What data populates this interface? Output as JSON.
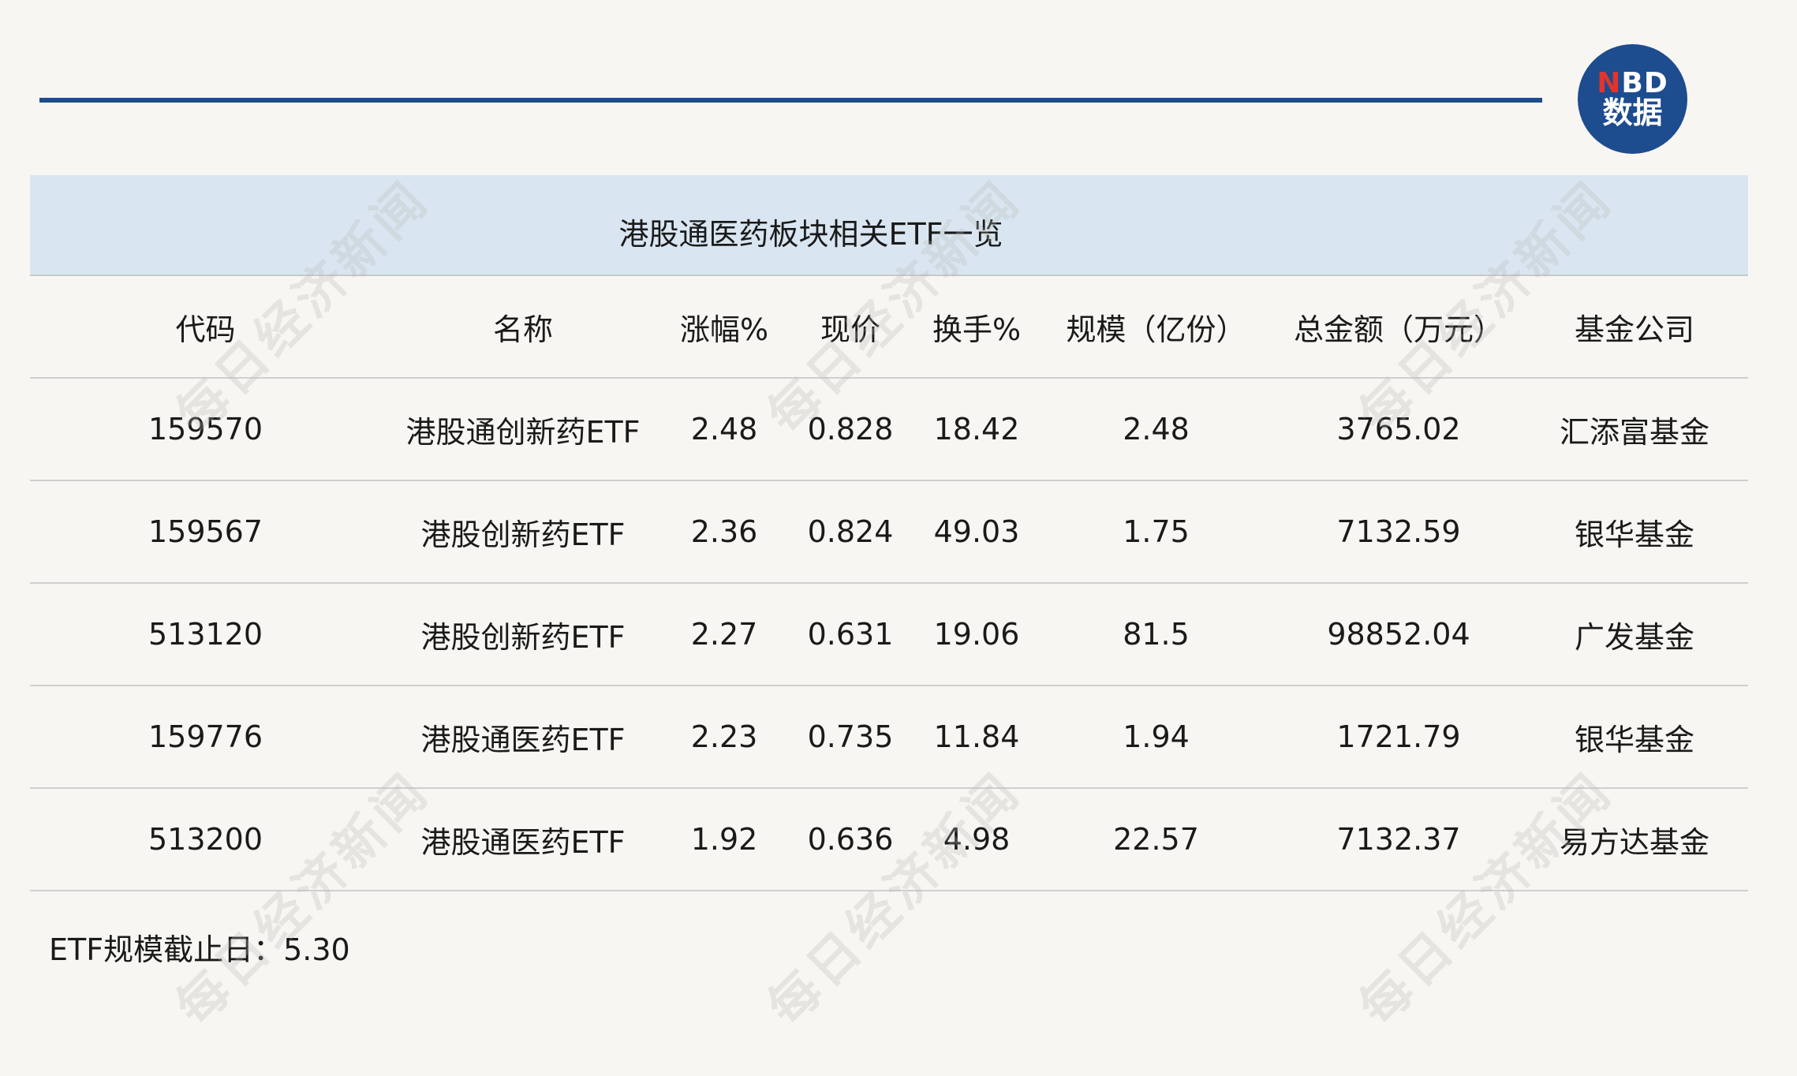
{
  "logo": {
    "line1_n": "N",
    "line1_rest": "BD",
    "line2": "数据"
  },
  "watermark": "每日经济新闻",
  "table": {
    "title": "港股通医药板块相关ETF一览",
    "columns": [
      "代码",
      "名称",
      "涨幅%",
      "现价",
      "换手%",
      "规模（亿份）",
      "总金额（万元）",
      "基金公司"
    ],
    "rows": [
      [
        "159570",
        "港股通创新药ETF",
        "2.48",
        "0.828",
        "18.42",
        "2.48",
        "3765.02",
        "汇添富基金"
      ],
      [
        "159567",
        "港股创新药ETF",
        "2.36",
        "0.824",
        "49.03",
        "1.75",
        "7132.59",
        "银华基金"
      ],
      [
        "513120",
        "港股创新药ETF",
        "2.27",
        "0.631",
        "19.06",
        "81.5",
        "98852.04",
        "广发基金"
      ],
      [
        "159776",
        "港股通医药ETF",
        "2.23",
        "0.735",
        "11.84",
        "1.94",
        "1721.79",
        "银华基金"
      ],
      [
        "513200",
        "港股通医药ETF",
        "1.92",
        "0.636",
        "4.98",
        "22.57",
        "7132.37",
        "易方达基金"
      ]
    ]
  },
  "footnote": "ETF规模截止日：5.30",
  "colors": {
    "accent_blue": "#1d4c8f",
    "title_band": "#d9e6f1",
    "logo_red": "#e2342b",
    "background": "#f8f6f2"
  }
}
